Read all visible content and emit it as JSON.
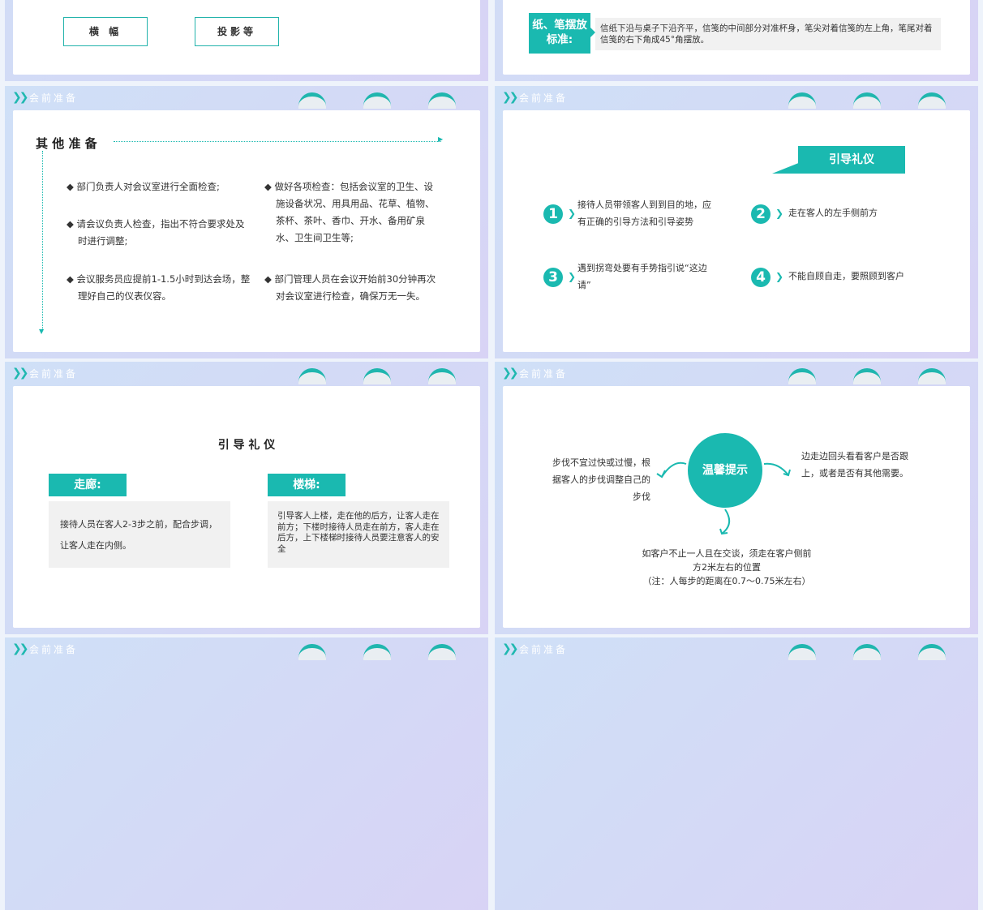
{
  "slides": {
    "s1": {
      "buttons": [
        "横 幅",
        "投影等"
      ]
    },
    "s2": {
      "label": "纸、笔摆放标准:",
      "text": "信纸下沿与桌子下沿齐平，信笺的中间部分对准杯身，笔尖对着信笺的左上角，笔尾对着信笺的右下角成45°角摆放。"
    },
    "s3": {
      "header": "会前准备",
      "heading": "其 他 准 备",
      "left_items": [
        "部门负责人对会议室进行全面检查;",
        "请会议负责人检查，指出不符合要求处及时进行调整;",
        "会议服务员应提前1-1.5小时到达会场，整理好自己的仪表仪容。"
      ],
      "right_items": [
        "做好各项检查：包括会议室的卫生、设施设备状况、用具用品、花草、植物、茶杯、茶叶、香巾、开水、备用矿泉水、卫生间卫生等;",
        "部门管理人员在会议开始前30分钟再次对会议室进行检查，确保万无一失。"
      ]
    },
    "s4": {
      "header": "会前准备",
      "badge": "引导礼仪",
      "items": [
        {
          "num": "1",
          "text": "接待人员带领客人到到目的地，应有正确的引导方法和引导姿势"
        },
        {
          "num": "2",
          "text": "走在客人的左手侧前方"
        },
        {
          "num": "3",
          "text": "遇到拐弯处要有手势指引说“这边请”"
        },
        {
          "num": "4",
          "text": "不能自顾自走，要照顾到客户"
        }
      ]
    },
    "s5": {
      "header": "会前准备",
      "heading": "引 导 礼 仪",
      "corridor_label": "走廊:",
      "corridor_text": "接待人员在客人2-3步之前，配合步调，让客人走在内侧。",
      "stairs_label": "楼梯:",
      "stairs_text": "引导客人上楼，走在他的后方，让客人走在前方；下楼时接待人员走在前方，客人走在后方，上下楼梯时接待人员要注意客人的安全"
    },
    "s6": {
      "header": "会前准备",
      "center": "温馨提示",
      "left": "步伐不宜过快或过慢，根据客人的步伐调整自己的步伐",
      "right": "边走边回头看看客户是否跟上，或者是否有其他需要。",
      "bottom": "如客户不止一人且在交谈，须走在客户侧前方2米左右的位置",
      "note": "（注：人每步的距离在0.7～0.75米左右）"
    },
    "s7": {
      "header": "会前准备"
    },
    "s8": {
      "header": "会前准备"
    }
  },
  "colors": {
    "accent": "#1ab9b0",
    "frame": "#d3dcf6"
  }
}
